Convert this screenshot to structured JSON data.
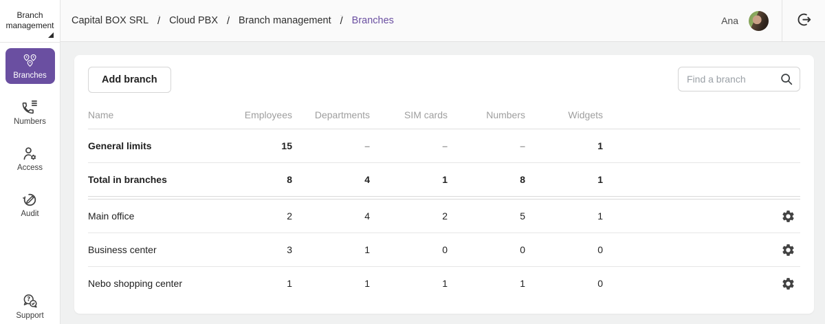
{
  "colors": {
    "accent": "#6a4fa1",
    "muted_text": "#9e9e9e"
  },
  "sidebar": {
    "title": "Branch management",
    "items": [
      {
        "label": "Branches",
        "icon": "branches-icon",
        "active": true
      },
      {
        "label": "Numbers",
        "icon": "numbers-icon",
        "active": false
      },
      {
        "label": "Access",
        "icon": "access-icon",
        "active": false
      },
      {
        "label": "Audit",
        "icon": "audit-icon",
        "active": false
      }
    ],
    "support": {
      "label": "Support",
      "icon": "support-icon"
    }
  },
  "header": {
    "breadcrumbs": [
      {
        "label": "Capital BOX SRL"
      },
      {
        "label": "Cloud PBX"
      },
      {
        "label": "Branch management"
      },
      {
        "label": "Branches",
        "current": true
      }
    ],
    "separator": "/",
    "user_name": "Ana",
    "avatar": "user-avatar",
    "logout_icon": "logout-icon"
  },
  "toolbar": {
    "add_button_label": "Add branch",
    "search_placeholder": "Find a branch",
    "search_icon": "search-icon"
  },
  "table": {
    "columns": [
      "Name",
      "Employees",
      "Departments",
      "SIM cards",
      "Numbers",
      "Widgets"
    ],
    "row_settings_icon": "gear-icon",
    "summary_rows": [
      {
        "name": "General limits",
        "values": [
          "15",
          "–",
          "–",
          "–",
          "1"
        ]
      },
      {
        "name": "Total in branches",
        "values": [
          "8",
          "4",
          "1",
          "8",
          "1"
        ]
      }
    ],
    "branch_rows": [
      {
        "name": "Main office",
        "values": [
          "2",
          "4",
          "2",
          "5",
          "1"
        ]
      },
      {
        "name": "Business center",
        "values": [
          "3",
          "1",
          "0",
          "0",
          "0"
        ]
      },
      {
        "name": "Nebo shopping center",
        "values": [
          "1",
          "1",
          "1",
          "1",
          "0"
        ]
      }
    ]
  }
}
